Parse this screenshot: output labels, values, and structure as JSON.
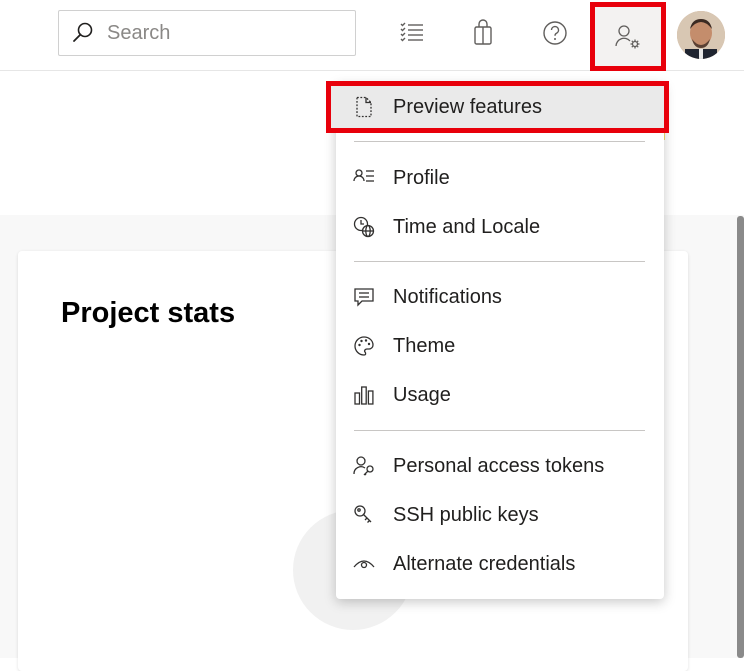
{
  "search": {
    "placeholder": "Search",
    "value": ""
  },
  "topbar": {
    "icons": [
      "search-icon",
      "work-items-icon",
      "marketplace-bag-icon",
      "help-icon",
      "user-settings-icon",
      "avatar"
    ]
  },
  "card": {
    "title": "Project stats"
  },
  "menu": {
    "items": [
      {
        "label": "Preview features",
        "icon": "preview-features-icon"
      },
      {
        "label": "Profile",
        "icon": "profile-icon"
      },
      {
        "label": "Time and Locale",
        "icon": "time-locale-icon"
      },
      {
        "label": "Notifications",
        "icon": "notifications-icon"
      },
      {
        "label": "Theme",
        "icon": "theme-palette-icon"
      },
      {
        "label": "Usage",
        "icon": "usage-chart-icon"
      },
      {
        "label": "Personal access tokens",
        "icon": "personal-access-tokens-icon"
      },
      {
        "label": "SSH public keys",
        "icon": "ssh-keys-icon"
      },
      {
        "label": "Alternate credentials",
        "icon": "alternate-credentials-icon"
      }
    ]
  },
  "colors": {
    "highlight": "#e8000b",
    "text": "#201f1e",
    "separator": "#c8c6c4"
  }
}
